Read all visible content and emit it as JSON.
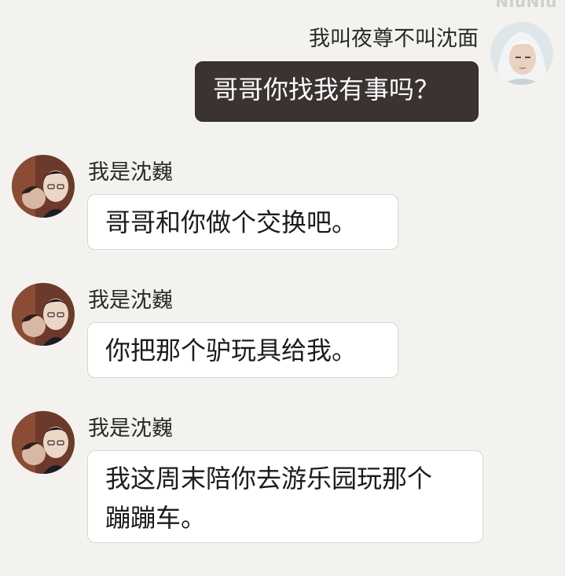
{
  "watermark": "NiuNiu",
  "messages": [
    {
      "direction": "outgoing",
      "sender": "我叫夜尊不叫沈面",
      "text": "哥哥你找我有事吗？",
      "avatar": "avatar-white-hair-man"
    },
    {
      "direction": "incoming",
      "sender": "我是沈巍",
      "text": "哥哥和你做个交换吧。",
      "avatar": "avatar-two-men-selfie"
    },
    {
      "direction": "incoming",
      "sender": "我是沈巍",
      "text": "你把那个驴玩具给我。",
      "avatar": "avatar-two-men-selfie"
    },
    {
      "direction": "incoming",
      "sender": "我是沈巍",
      "text": "我这周末陪你去游乐园玩那个\n蹦蹦车。",
      "avatar": "avatar-two-men-selfie"
    }
  ],
  "colors": {
    "background": "#f4f2ef",
    "outgoing_bubble": "#3b3232",
    "incoming_bubble": "#ffffff"
  }
}
